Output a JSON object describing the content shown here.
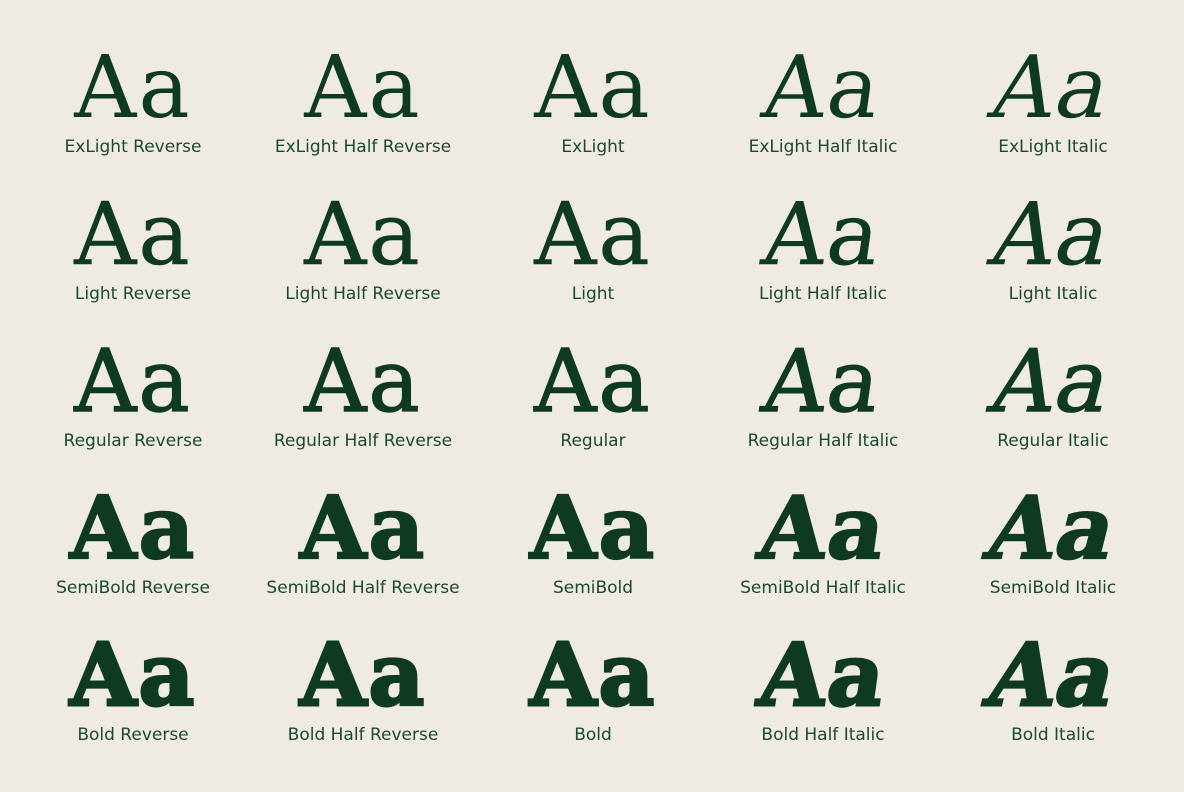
{
  "specimen_glyph": "Aa",
  "colors": {
    "background": "#efebe4",
    "ink": "#0e3a21"
  },
  "styles": [
    [
      "ExLight Reverse",
      "ExLight Half Reverse",
      "ExLight",
      "ExLight Half Italic",
      "ExLight Italic"
    ],
    [
      "Light Reverse",
      "Light Half Reverse",
      "Light",
      "Light Half Italic",
      "Light Italic"
    ],
    [
      "Regular Reverse",
      "Regular Half Reverse",
      "Regular",
      "Regular Half Italic",
      "Regular Italic"
    ],
    [
      "SemiBold Reverse",
      "SemiBold Half Reverse",
      "SemiBold",
      "SemiBold Half Italic",
      "SemiBold Italic"
    ],
    [
      "Bold Reverse",
      "Bold Half Reverse",
      "Bold",
      "Bold Half Italic",
      "Bold Italic"
    ]
  ]
}
